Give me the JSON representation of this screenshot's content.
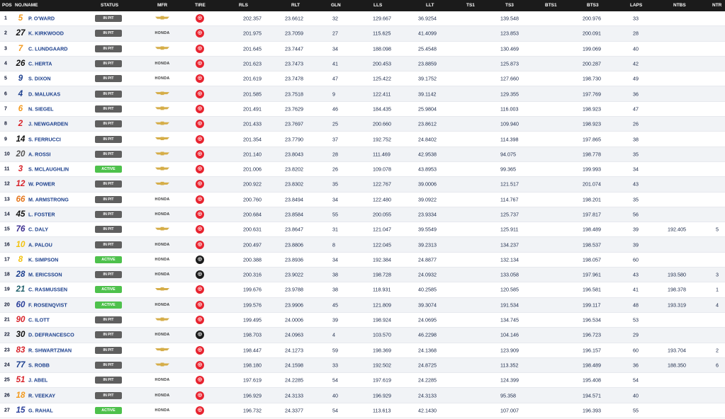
{
  "columns": {
    "pos": "POS",
    "no_name": "NO./NAME",
    "status": "STATUS",
    "mfr": "MFR",
    "tire": "TIRE",
    "rls": "RLS",
    "rlt": "RLT",
    "gln": "GLN",
    "lls": "LLS",
    "llt": "LLT",
    "ts1": "TS1",
    "ts3": "TS3",
    "bts1": "BTS1",
    "bts3": "BTS3",
    "laps": "LAPS",
    "ntbs": "NTBS",
    "ntr": "NTR"
  },
  "colors": {
    "header_bg": "#1b1b1b",
    "in_pit": "#5f5f5f",
    "active": "#4ec14c",
    "tire_primary": "#e8232f",
    "tire_alternate": "#1a1a1a",
    "name_blue": "#1b3f8c"
  },
  "rows": [
    {
      "pos": "1",
      "num": "5",
      "num_color": "#f39a1e",
      "name": "P. O'WARD",
      "status": "IN PIT",
      "status_type": "pit",
      "mfr": "chevrolet",
      "tire": "primary",
      "rls": "202.357",
      "rlt": "23.6612",
      "gln": "32",
      "lls": "129.667",
      "llt": "36.9254",
      "ts3": "139.548",
      "bts3": "200.976",
      "laps": "33",
      "ntbs": "",
      "ntr": ""
    },
    {
      "pos": "2",
      "num": "27",
      "num_color": "#111111",
      "name": "K. KIRKWOOD",
      "status": "IN PIT",
      "status_type": "pit",
      "mfr": "honda",
      "tire": "primary",
      "rls": "201.975",
      "rlt": "23.7059",
      "gln": "27",
      "lls": "115.625",
      "llt": "41.4099",
      "ts3": "123.853",
      "bts3": "200.091",
      "laps": "28",
      "ntbs": "",
      "ntr": ""
    },
    {
      "pos": "3",
      "num": "7",
      "num_color": "#f39a1e",
      "name": "C. LUNDGAARD",
      "status": "IN PIT",
      "status_type": "pit",
      "mfr": "chevrolet",
      "tire": "primary",
      "rls": "201.645",
      "rlt": "23.7447",
      "gln": "34",
      "lls": "188.098",
      "llt": "25.4548",
      "ts3": "130.469",
      "bts3": "199.069",
      "laps": "40",
      "ntbs": "",
      "ntr": ""
    },
    {
      "pos": "4",
      "num": "26",
      "num_color": "#111111",
      "name": "C. HERTA",
      "status": "IN PIT",
      "status_type": "pit",
      "mfr": "honda",
      "tire": "primary",
      "rls": "201.623",
      "rlt": "23.7473",
      "gln": "41",
      "lls": "200.453",
      "llt": "23.8859",
      "ts3": "125.873",
      "bts3": "200.287",
      "laps": "42",
      "ntbs": "",
      "ntr": ""
    },
    {
      "pos": "5",
      "num": "9",
      "num_color": "#1c3f8f",
      "name": "S. DIXON",
      "status": "IN PIT",
      "status_type": "pit",
      "mfr": "honda",
      "tire": "primary",
      "rls": "201.619",
      "rlt": "23.7478",
      "gln": "47",
      "lls": "125.422",
      "llt": "39.1752",
      "ts3": "127.660",
      "bts3": "198.730",
      "laps": "49",
      "ntbs": "",
      "ntr": ""
    },
    {
      "pos": "6",
      "num": "4",
      "num_color": "#1c3f8f",
      "name": "D. MALUKAS",
      "status": "IN PIT",
      "status_type": "pit",
      "mfr": "chevrolet",
      "tire": "primary",
      "rls": "201.585",
      "rlt": "23.7518",
      "gln": "9",
      "lls": "122.411",
      "llt": "39.1142",
      "ts3": "129.355",
      "bts3": "197.769",
      "laps": "36",
      "ntbs": "",
      "ntr": ""
    },
    {
      "pos": "7",
      "num": "6",
      "num_color": "#f39a1e",
      "name": "N. SIEGEL",
      "status": "IN PIT",
      "status_type": "pit",
      "mfr": "chevrolet",
      "tire": "primary",
      "rls": "201.491",
      "rlt": "23.7629",
      "gln": "46",
      "lls": "184.435",
      "llt": "25.9804",
      "ts3": "116.003",
      "bts3": "198.923",
      "laps": "47",
      "ntbs": "",
      "ntr": ""
    },
    {
      "pos": "8",
      "num": "2",
      "num_color": "#d8232a",
      "name": "J. NEWGARDEN",
      "status": "IN PIT",
      "status_type": "pit",
      "mfr": "chevrolet",
      "tire": "primary",
      "rls": "201.433",
      "rlt": "23.7697",
      "gln": "25",
      "lls": "200.660",
      "llt": "23.8612",
      "ts3": "109.940",
      "bts3": "198.923",
      "laps": "26",
      "ntbs": "",
      "ntr": ""
    },
    {
      "pos": "9",
      "num": "14",
      "num_color": "#111111",
      "name": "S. FERRUCCI",
      "status": "IN PIT",
      "status_type": "pit",
      "mfr": "chevrolet",
      "tire": "primary",
      "rls": "201.354",
      "rlt": "23.7790",
      "gln": "37",
      "lls": "192.752",
      "llt": "24.8402",
      "ts3": "114.398",
      "bts3": "197.865",
      "laps": "38",
      "ntbs": "",
      "ntr": ""
    },
    {
      "pos": "10",
      "num": "20",
      "num_color": "#555555",
      "name": "A. ROSSI",
      "status": "IN PIT",
      "status_type": "pit",
      "mfr": "chevrolet",
      "tire": "primary",
      "rls": "201.140",
      "rlt": "23.8043",
      "gln": "28",
      "lls": "111.469",
      "llt": "42.9538",
      "ts3": "94.075",
      "bts3": "198.778",
      "laps": "35",
      "ntbs": "",
      "ntr": ""
    },
    {
      "pos": "11",
      "num": "3",
      "num_color": "#d8232a",
      "name": "S. MCLAUGHLIN",
      "status": "ACTIVE",
      "status_type": "active",
      "mfr": "chevrolet",
      "tire": "primary",
      "rls": "201.006",
      "rlt": "23.8202",
      "gln": "26",
      "lls": "109.078",
      "llt": "43.8953",
      "ts3": "99.365",
      "bts3": "199.993",
      "laps": "34",
      "ntbs": "",
      "ntr": ""
    },
    {
      "pos": "12",
      "num": "12",
      "num_color": "#d8232a",
      "name": "W. POWER",
      "status": "IN PIT",
      "status_type": "pit",
      "mfr": "chevrolet",
      "tire": "primary",
      "rls": "200.922",
      "rlt": "23.8302",
      "gln": "35",
      "lls": "122.767",
      "llt": "39.0006",
      "ts3": "121.517",
      "bts3": "201.074",
      "laps": "43",
      "ntbs": "",
      "ntr": ""
    },
    {
      "pos": "13",
      "num": "66",
      "num_color": "#e5761c",
      "name": "M. ARMSTRONG",
      "status": "IN PIT",
      "status_type": "pit",
      "mfr": "honda",
      "tire": "primary",
      "rls": "200.760",
      "rlt": "23.8494",
      "gln": "34",
      "lls": "122.480",
      "llt": "39.0922",
      "ts3": "114.767",
      "bts3": "198.201",
      "laps": "35",
      "ntbs": "",
      "ntr": ""
    },
    {
      "pos": "14",
      "num": "45",
      "num_color": "#111111",
      "name": "L. FOSTER",
      "status": "IN PIT",
      "status_type": "pit",
      "mfr": "honda",
      "tire": "primary",
      "rls": "200.684",
      "rlt": "23.8584",
      "gln": "55",
      "lls": "200.055",
      "llt": "23.9334",
      "ts3": "125.737",
      "bts3": "197.817",
      "laps": "56",
      "ntbs": "",
      "ntr": ""
    },
    {
      "pos": "15",
      "num": "76",
      "num_color": "#3b2d8f",
      "name": "C. DALY",
      "status": "IN PIT",
      "status_type": "pit",
      "mfr": "chevrolet",
      "tire": "primary",
      "rls": "200.631",
      "rlt": "23.8647",
      "gln": "31",
      "lls": "121.047",
      "llt": "39.5549",
      "ts3": "125.911",
      "bts3": "198.489",
      "laps": "39",
      "ntbs": "192.405",
      "ntr": "5"
    },
    {
      "pos": "16",
      "num": "10",
      "num_color": "#f2c20f",
      "name": "A. PALOU",
      "status": "IN PIT",
      "status_type": "pit",
      "mfr": "honda",
      "tire": "primary",
      "rls": "200.497",
      "rlt": "23.8806",
      "gln": "8",
      "lls": "122.045",
      "llt": "39.2313",
      "ts3": "134.237",
      "bts3": "198.537",
      "laps": "39",
      "ntbs": "",
      "ntr": ""
    },
    {
      "pos": "17",
      "num": "8",
      "num_color": "#f2c20f",
      "name": "K. SIMPSON",
      "status": "ACTIVE",
      "status_type": "active",
      "mfr": "honda",
      "tire": "alternate",
      "rls": "200.388",
      "rlt": "23.8936",
      "gln": "34",
      "lls": "192.384",
      "llt": "24.8877",
      "ts3": "132.134",
      "bts3": "198.057",
      "laps": "60",
      "ntbs": "",
      "ntr": ""
    },
    {
      "pos": "18",
      "num": "28",
      "num_color": "#1c3f8f",
      "name": "M. ERICSSON",
      "status": "IN PIT",
      "status_type": "pit",
      "mfr": "honda",
      "tire": "alternate",
      "rls": "200.316",
      "rlt": "23.9022",
      "gln": "38",
      "lls": "198.728",
      "llt": "24.0932",
      "ts3": "133.058",
      "bts3": "197.961",
      "laps": "43",
      "ntbs": "193.580",
      "ntr": "3"
    },
    {
      "pos": "19",
      "num": "21",
      "num_color": "#1f5f6b",
      "name": "C. RASMUSSEN",
      "status": "ACTIVE",
      "status_type": "active",
      "mfr": "chevrolet",
      "tire": "primary",
      "rls": "199.676",
      "rlt": "23.9788",
      "gln": "38",
      "lls": "118.931",
      "llt": "40.2585",
      "ts3": "120.585",
      "bts3": "196.581",
      "laps": "41",
      "ntbs": "198.378",
      "ntr": "1"
    },
    {
      "pos": "20",
      "num": "60",
      "num_color": "#2a3f9a",
      "name": "F. ROSENQVIST",
      "status": "ACTIVE",
      "status_type": "active",
      "mfr": "honda",
      "tire": "primary",
      "rls": "199.576",
      "rlt": "23.9906",
      "gln": "45",
      "lls": "121.809",
      "llt": "39.3074",
      "ts3": "191.534",
      "bts3": "199.117",
      "laps": "48",
      "ntbs": "193.319",
      "ntr": "4"
    },
    {
      "pos": "21",
      "num": "90",
      "num_color": "#d8232a",
      "name": "C. ILOTT",
      "status": "IN PIT",
      "status_type": "pit",
      "mfr": "chevrolet",
      "tire": "primary",
      "rls": "199.495",
      "rlt": "24.0006",
      "gln": "39",
      "lls": "198.924",
      "llt": "24.0695",
      "ts3": "134.745",
      "bts3": "196.534",
      "laps": "53",
      "ntbs": "",
      "ntr": ""
    },
    {
      "pos": "22",
      "num": "30",
      "num_color": "#111111",
      "name": "D. DEFRANCESCO",
      "status": "IN PIT",
      "status_type": "pit",
      "mfr": "honda",
      "tire": "alternate",
      "rls": "198.703",
      "rlt": "24.0963",
      "gln": "4",
      "lls": "103.570",
      "llt": "46.2298",
      "ts3": "104.146",
      "bts3": "196.723",
      "laps": "29",
      "ntbs": "",
      "ntr": ""
    },
    {
      "pos": "23",
      "num": "83",
      "num_color": "#d8232a",
      "name": "R. SHWARTZMAN",
      "status": "IN PIT",
      "status_type": "pit",
      "mfr": "chevrolet",
      "tire": "primary",
      "rls": "198.447",
      "rlt": "24.1273",
      "gln": "59",
      "lls": "198.369",
      "llt": "24.1368",
      "ts3": "123.909",
      "bts3": "196.157",
      "laps": "60",
      "ntbs": "193.704",
      "ntr": "2"
    },
    {
      "pos": "24",
      "num": "77",
      "num_color": "#1c3f8f",
      "name": "S. ROBB",
      "status": "IN PIT",
      "status_type": "pit",
      "mfr": "chevrolet",
      "tire": "primary",
      "rls": "198.180",
      "rlt": "24.1598",
      "gln": "33",
      "lls": "192.502",
      "llt": "24.8725",
      "ts3": "113.352",
      "bts3": "198.489",
      "laps": "36",
      "ntbs": "188.350",
      "ntr": "6"
    },
    {
      "pos": "25",
      "num": "51",
      "num_color": "#d8232a",
      "name": "J. ABEL",
      "status": "IN PIT",
      "status_type": "pit",
      "mfr": "honda",
      "tire": "primary",
      "rls": "197.619",
      "rlt": "24.2285",
      "gln": "54",
      "lls": "197.619",
      "llt": "24.2285",
      "ts3": "124.399",
      "bts3": "195.408",
      "laps": "54",
      "ntbs": "",
      "ntr": ""
    },
    {
      "pos": "26",
      "num": "18",
      "num_color": "#f39a1e",
      "name": "R. VEEKAY",
      "status": "IN PIT",
      "status_type": "pit",
      "mfr": "honda",
      "tire": "primary",
      "rls": "196.929",
      "rlt": "24.3133",
      "gln": "40",
      "lls": "196.929",
      "llt": "24.3133",
      "ts3": "95.358",
      "bts3": "194.571",
      "laps": "40",
      "ntbs": "",
      "ntr": ""
    },
    {
      "pos": "27",
      "num": "15",
      "num_color": "#2a3f9a",
      "name": "G. RAHAL",
      "status": "ACTIVE",
      "status_type": "active",
      "mfr": "honda",
      "tire": "primary",
      "rls": "196.732",
      "rlt": "24.3377",
      "gln": "54",
      "lls": "113.613",
      "llt": "42.1430",
      "ts3": "107.007",
      "bts3": "196.393",
      "laps": "55",
      "ntbs": "",
      "ntr": ""
    }
  ]
}
